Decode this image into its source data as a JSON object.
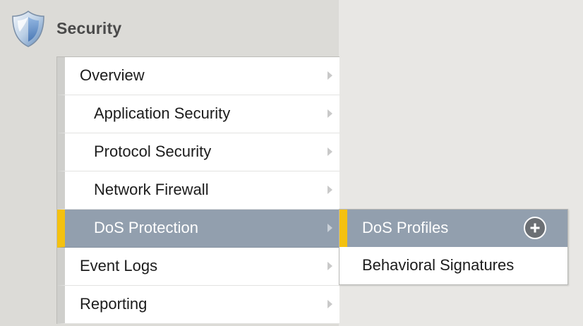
{
  "header": {
    "title": "Security",
    "icon": "shield-icon"
  },
  "menu": {
    "items": [
      {
        "label": "Overview",
        "level": 0,
        "active": false
      },
      {
        "label": "Application Security",
        "level": 1,
        "active": false
      },
      {
        "label": "Protocol Security",
        "level": 1,
        "active": false
      },
      {
        "label": "Network Firewall",
        "level": 1,
        "active": false
      },
      {
        "label": "DoS Protection",
        "level": 1,
        "active": true
      },
      {
        "label": "Event Logs",
        "level": 0,
        "active": false
      },
      {
        "label": "Reporting",
        "level": 0,
        "active": false
      }
    ]
  },
  "submenu": {
    "items": [
      {
        "label": "DoS Profiles",
        "active": true,
        "has_add": true
      },
      {
        "label": "Behavioral Signatures",
        "active": false,
        "has_add": false
      }
    ]
  },
  "colors": {
    "active_bg": "#929fae",
    "active_accent": "#f4c10f",
    "panel_bg": "#dcdbd7"
  }
}
